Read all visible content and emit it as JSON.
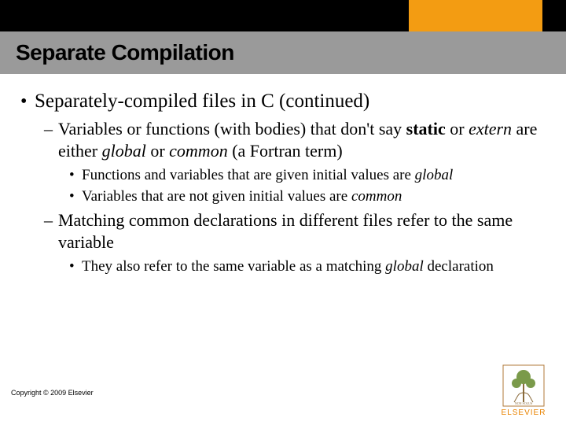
{
  "title": "Separate Compilation",
  "b1": "Separately-compiled files in C (continued)",
  "b1a_pre": "Variables or functions (with bodies) that don't say ",
  "b1a_kw1": "static",
  "b1a_mid1": " or ",
  "b1a_kw2": "extern",
  "b1a_mid2": " are either ",
  "b1a_kw3": "global",
  "b1a_mid3": " or ",
  "b1a_kw4": "common",
  "b1a_post": " (a Fortran term)",
  "b1a_i_pre": "Functions and variables that are given initial values are ",
  "b1a_i_kw": "global",
  "b1a_ii_pre": "Variables that are not given initial values are ",
  "b1a_ii_kw": "common",
  "b1b": "Matching common declarations in different files refer to the same variable",
  "b1b_i_pre": "They also refer to the same variable as a matching ",
  "b1b_i_kw": "global",
  "b1b_i_post": " declaration",
  "copyright": "Copyright © 2009 Elsevier",
  "logo_label": "ELSEVIER"
}
